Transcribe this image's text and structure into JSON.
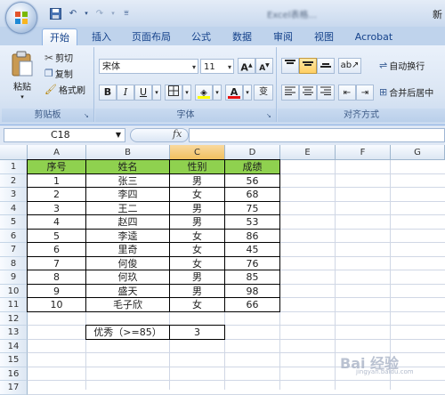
{
  "titlebar": {
    "title_blurred": "Excel表格...",
    "right_char": "新"
  },
  "tabs": [
    {
      "label": "开始"
    },
    {
      "label": "插入"
    },
    {
      "label": "页面布局"
    },
    {
      "label": "公式"
    },
    {
      "label": "数据"
    },
    {
      "label": "审阅"
    },
    {
      "label": "视图"
    },
    {
      "label": "Acrobat"
    }
  ],
  "ribbon": {
    "clipboard": {
      "paste": "粘贴",
      "cut": "剪切",
      "copy": "复制",
      "format_painter": "格式刷",
      "label": "剪贴板"
    },
    "font": {
      "font_name": "宋体",
      "font_size": "11",
      "grow": "A",
      "shrink": "A",
      "bold": "B",
      "italic": "I",
      "underline": "U",
      "wen": "变",
      "label": "字体"
    },
    "alignment": {
      "wrap": "自动换行",
      "merge": "合并后居中",
      "label": "对齐方式"
    }
  },
  "formula_bar": {
    "name_box": "C18",
    "fx": "fx",
    "formula": ""
  },
  "columns": [
    "A",
    "B",
    "C",
    "D",
    "E",
    "F",
    "G"
  ],
  "rows": [
    "1",
    "2",
    "3",
    "4",
    "5",
    "6",
    "7",
    "8",
    "9",
    "10",
    "11",
    "12",
    "13",
    "14",
    "15",
    "16",
    "17"
  ],
  "table": {
    "headers": [
      "序号",
      "姓名",
      "性别",
      "成绩"
    ],
    "records": [
      [
        "1",
        "张三",
        "男",
        "56"
      ],
      [
        "2",
        "李四",
        "女",
        "68"
      ],
      [
        "3",
        "王二",
        "男",
        "75"
      ],
      [
        "4",
        "赵四",
        "男",
        "53"
      ],
      [
        "5",
        "李逵",
        "女",
        "86"
      ],
      [
        "6",
        "里奇",
        "女",
        "45"
      ],
      [
        "7",
        "何俊",
        "女",
        "76"
      ],
      [
        "8",
        "何玖",
        "男",
        "85"
      ],
      [
        "9",
        "盛天",
        "男",
        "98"
      ],
      [
        "10",
        "毛子欣",
        "女",
        "66"
      ]
    ]
  },
  "summary": {
    "label": "优秀（>=85）",
    "value": "3"
  },
  "watermark": {
    "text": "Bai 经验",
    "sub": "jingyan.baidu.com"
  },
  "colors": {
    "header_fill": "#8fd14f",
    "ribbon_bg": "#dbe6f4",
    "tab_text": "#15428b"
  }
}
